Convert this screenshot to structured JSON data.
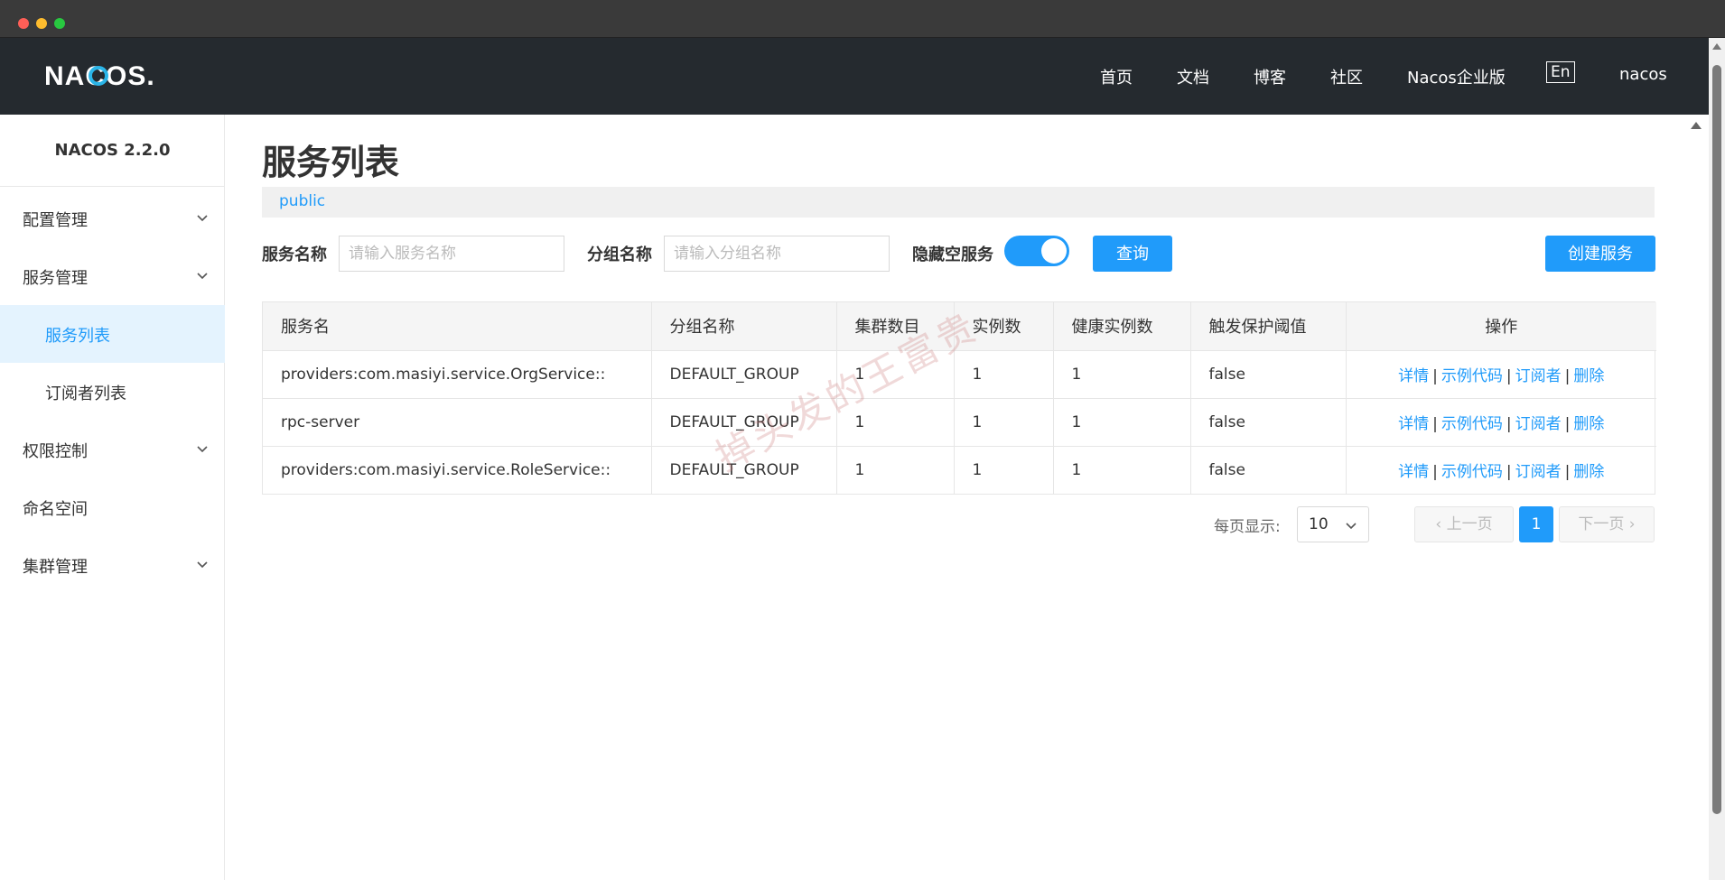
{
  "header": {
    "logo_text": "NACOS.",
    "nav": [
      "首页",
      "文档",
      "博客",
      "社区",
      "Nacos企业版"
    ],
    "lang": "En",
    "user": "nacos"
  },
  "sidebar": {
    "version": "NACOS 2.2.0",
    "items": [
      {
        "label": "配置管理",
        "expandable": true
      },
      {
        "label": "服务管理",
        "expandable": true
      },
      {
        "label": "服务列表",
        "active": true
      },
      {
        "label": "订阅者列表"
      },
      {
        "label": "权限控制",
        "expandable": true
      },
      {
        "label": "命名空间"
      },
      {
        "label": "集群管理",
        "expandable": true
      }
    ]
  },
  "main": {
    "title": "服务列表",
    "namespace": "public",
    "filters": {
      "service_name_label": "服务名称",
      "service_name_placeholder": "请输入服务名称",
      "group_name_label": "分组名称",
      "group_name_placeholder": "请输入分组名称",
      "hide_empty_label": "隐藏空服务",
      "hide_empty_on": true,
      "query_button": "查询",
      "create_button": "创建服务"
    },
    "table": {
      "headers": [
        "服务名",
        "分组名称",
        "集群数目",
        "实例数",
        "健康实例数",
        "触发保护阈值",
        "操作"
      ],
      "rows": [
        [
          "providers:com.masiyi.service.OrgService::",
          "DEFAULT_GROUP",
          "1",
          "1",
          "1",
          "false"
        ],
        [
          "rpc-server",
          "DEFAULT_GROUP",
          "1",
          "1",
          "1",
          "false"
        ],
        [
          "providers:com.masiyi.service.RoleService::",
          "DEFAULT_GROUP",
          "1",
          "1",
          "1",
          "false"
        ]
      ],
      "actions": [
        "详情",
        "示例代码",
        "订阅者",
        "删除"
      ]
    },
    "pagination": {
      "page_size_label": "每页显示:",
      "page_size": "10",
      "prev": "上一页",
      "current": "1",
      "next": "下一页"
    },
    "watermark": "掉头发的王富贵"
  },
  "colors": {
    "accent": "#209bfa",
    "header_bg": "#252a2f",
    "active_menu_bg": "#e4f3fe"
  }
}
